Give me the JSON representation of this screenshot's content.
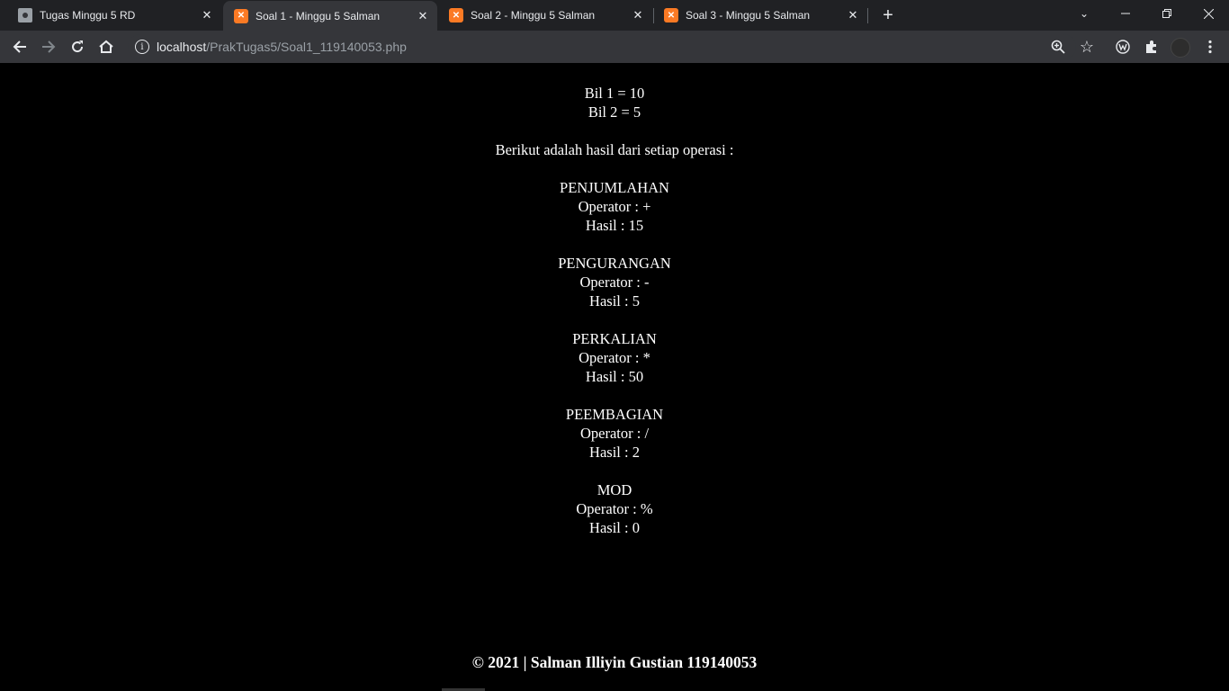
{
  "tabs": [
    {
      "title": "Tugas Minggu 5 RD",
      "favicon": "page-icon",
      "active": false
    },
    {
      "title": "Soal 1 - Minggu 5 Salman",
      "favicon": "xampp-icon",
      "active": true
    },
    {
      "title": "Soal 2 - Minggu 5 Salman",
      "favicon": "xampp-icon",
      "active": false
    },
    {
      "title": "Soal 3 - Minggu 5 Salman",
      "favicon": "xampp-icon",
      "active": false
    }
  ],
  "address_bar": {
    "host": "localhost",
    "path": "/PrakTugas5/Soal1_119140053.php"
  },
  "page": {
    "bil1": "Bil 1 = 10",
    "bil2": "Bil 2 = 5",
    "intro": "Berikut adalah hasil dari setiap operasi :",
    "operations": [
      {
        "name": "PENJUMLAHAN",
        "operator": "Operator : +",
        "result": "Hasil : 15"
      },
      {
        "name": "PENGURANGAN",
        "operator": "Operator : -",
        "result": "Hasil : 5"
      },
      {
        "name": "PERKALIAN",
        "operator": "Operator : *",
        "result": "Hasil : 50"
      },
      {
        "name": "PEEMBAGIAN",
        "operator": "Operator : /",
        "result": "Hasil : 2"
      },
      {
        "name": "MOD",
        "operator": "Operator : %",
        "result": "Hasil : 0"
      }
    ],
    "footer": "© 2021 | Salman Illiyin Gustian 119140053"
  },
  "colors": {
    "tabstrip_bg": "#202124",
    "toolbar_bg": "#35363a",
    "page_bg": "#000000",
    "text": "#ffffff",
    "xampp_accent": "#fb7a24"
  }
}
